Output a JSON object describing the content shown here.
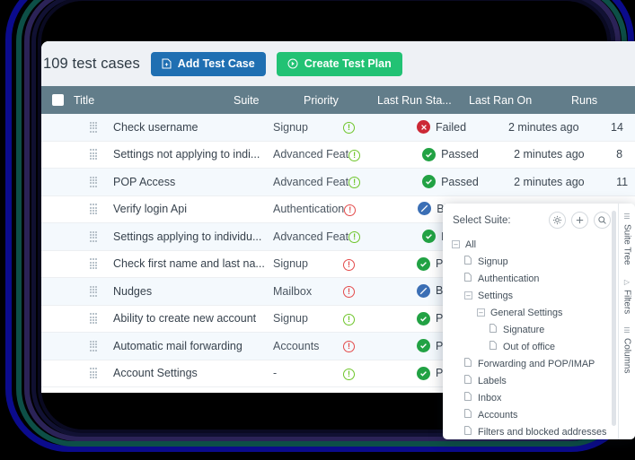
{
  "toolbar": {
    "count_label": "109 test cases",
    "add_test_case_label": "Add Test Case",
    "create_test_plan_label": "Create Test Plan",
    "primary_color": "#1f6fb2",
    "success_color": "#22c274"
  },
  "table": {
    "header_bg": "#627d8a",
    "columns": [
      {
        "key": "title",
        "label": "Title"
      },
      {
        "key": "suite",
        "label": "Suite"
      },
      {
        "key": "prio",
        "label": "Priority"
      },
      {
        "key": "status",
        "label": "Last Run Sta..."
      },
      {
        "key": "ranon",
        "label": "Last Ran On"
      },
      {
        "key": "runs",
        "label": "Runs"
      }
    ],
    "rows": [
      {
        "title": "Check username",
        "suite": "Signup",
        "priority": "low",
        "status": "Failed",
        "status_kind": "fail",
        "last_ran_on": "2 minutes ago",
        "runs": "14"
      },
      {
        "title": "Settings not applying to indi...",
        "suite": "Advanced Feat",
        "priority": "low",
        "status": "Passed",
        "status_kind": "pass",
        "last_ran_on": "2 minutes ago",
        "runs": "8"
      },
      {
        "title": "POP Access",
        "suite": "Advanced Feat",
        "priority": "low",
        "status": "Passed",
        "status_kind": "pass",
        "last_ran_on": "2 minutes ago",
        "runs": "11"
      },
      {
        "title": "Verify login Api",
        "suite": "Authentication",
        "priority": "high",
        "status": "Blocked",
        "status_kind": "block",
        "last_ran_on": "",
        "runs": ""
      },
      {
        "title": "Settings applying to individu...",
        "suite": "Advanced Feat",
        "priority": "low",
        "status": "Passed",
        "status_kind": "pass",
        "last_ran_on": "",
        "runs": ""
      },
      {
        "title": "Check first name and last na...",
        "suite": "Signup",
        "priority": "high",
        "status": "Passed",
        "status_kind": "pass",
        "last_ran_on": "",
        "runs": ""
      },
      {
        "title": "Nudges",
        "suite": "Mailbox",
        "priority": "high",
        "status": "Blocked",
        "status_kind": "block",
        "last_ran_on": "",
        "runs": ""
      },
      {
        "title": "Ability to create new account",
        "suite": "Signup",
        "priority": "low",
        "status": "Passed",
        "status_kind": "pass",
        "last_ran_on": "",
        "runs": ""
      },
      {
        "title": "Automatic mail forwarding",
        "suite": "Accounts",
        "priority": "high",
        "status": "Passed",
        "status_kind": "pass",
        "last_ran_on": "",
        "runs": ""
      },
      {
        "title": "Account Settings",
        "suite": "-",
        "priority": "low",
        "status": "Passed",
        "status_kind": "pass",
        "last_ran_on": "",
        "runs": ""
      }
    ]
  },
  "suite_panel": {
    "title": "Select Suite:",
    "actions": [
      {
        "name": "gear-icon",
        "label": "Settings"
      },
      {
        "name": "plus-icon",
        "label": "Add"
      },
      {
        "name": "search-icon",
        "label": "Search"
      }
    ],
    "tree": [
      {
        "label": "All",
        "depth": 0,
        "type": "folder",
        "expanded": true
      },
      {
        "label": "Signup",
        "depth": 1,
        "type": "file"
      },
      {
        "label": "Authentication",
        "depth": 1,
        "type": "file"
      },
      {
        "label": "Settings",
        "depth": 1,
        "type": "folder",
        "expanded": true
      },
      {
        "label": "General Settings",
        "depth": 2,
        "type": "folder",
        "expanded": true
      },
      {
        "label": "Signature",
        "depth": 3,
        "type": "file"
      },
      {
        "label": "Out of office",
        "depth": 3,
        "type": "file"
      },
      {
        "label": "Forwarding and POP/IMAP",
        "depth": 1,
        "type": "file"
      },
      {
        "label": "Labels",
        "depth": 1,
        "type": "file"
      },
      {
        "label": "Inbox",
        "depth": 1,
        "type": "file"
      },
      {
        "label": "Accounts",
        "depth": 1,
        "type": "file"
      },
      {
        "label": "Filters and blocked addresses",
        "depth": 1,
        "type": "file"
      }
    ],
    "side_tabs": [
      {
        "label": "Suite Tree",
        "icon": "tree-icon"
      },
      {
        "label": "Filters",
        "icon": "filter-icon"
      },
      {
        "label": "Columns",
        "icon": "columns-icon"
      }
    ]
  },
  "decor": {
    "ring_colors": [
      "#0b0b8c",
      "#0d4f47",
      "#2b2357",
      "#111133",
      "#0a0a22"
    ],
    "background": "#000000"
  }
}
